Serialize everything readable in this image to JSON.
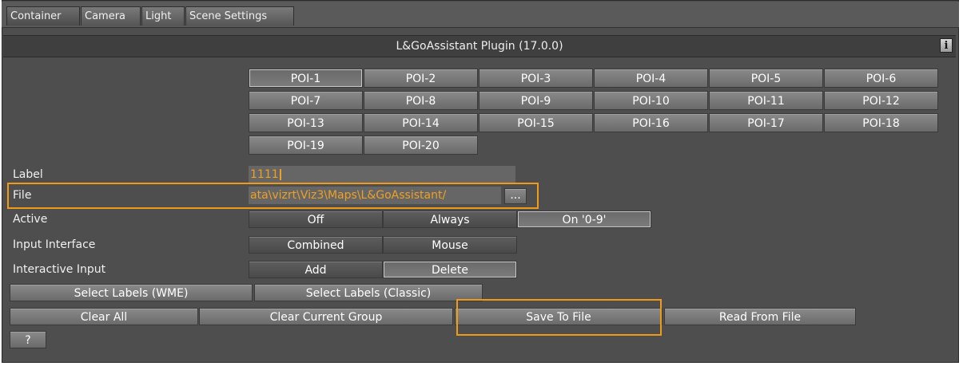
{
  "tabs": [
    "Container",
    "Camera",
    "Light",
    "Scene Settings"
  ],
  "plugin_title": "L&GoAssistant Plugin (17.0.0)",
  "info_icon_label": "i",
  "poi_buttons": [
    "POI-1",
    "POI-2",
    "POI-3",
    "POI-4",
    "POI-5",
    "POI-6",
    "POI-7",
    "POI-8",
    "POI-9",
    "POI-10",
    "POI-11",
    "POI-12",
    "POI-13",
    "POI-14",
    "POI-15",
    "POI-16",
    "POI-17",
    "POI-18",
    "POI-19",
    "POI-20"
  ],
  "label_row": {
    "label": "Label",
    "value": "1111"
  },
  "file_row": {
    "label": "File",
    "value": "ata\\vizrt\\Viz3\\Maps\\L&GoAssistant/",
    "browse": "..."
  },
  "active_row": {
    "label": "Active",
    "options": [
      "Off",
      "Always",
      "On '0-9'"
    ],
    "selected": "On '0-9'"
  },
  "input_interface_row": {
    "label": "Input Interface",
    "options": [
      "Combined",
      "Mouse"
    ]
  },
  "interactive_input_row": {
    "label": "Interactive Input",
    "options": [
      "Add",
      "Delete"
    ],
    "selected": "Delete"
  },
  "select_labels": [
    "Select Labels (WME)",
    "Select Labels (Classic)"
  ],
  "actions": [
    "Clear All",
    "Clear Current Group",
    "Save To File",
    "Read From File"
  ],
  "help_button": "?",
  "colors": {
    "highlight": "#f09a18",
    "field_text": "#f0a020",
    "panel_bg": "#4e4e4e"
  }
}
